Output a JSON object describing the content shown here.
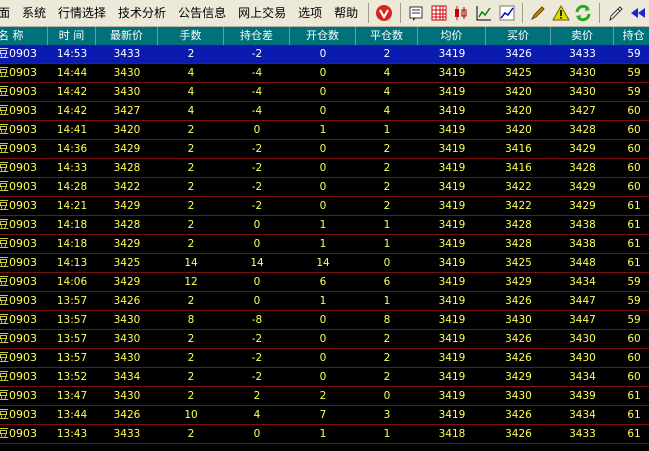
{
  "menu": [
    "面",
    "系统",
    "行情选择",
    "技术分析",
    "公告信息",
    "网上交易",
    "选项",
    "帮助"
  ],
  "toolbar": [
    {
      "icon": "red-circle-v-icon",
      "color": "#d22"
    },
    {
      "icon": "notepad-icon",
      "color": "#333"
    },
    {
      "icon": "grid-table-icon",
      "color": "#c00"
    },
    {
      "icon": "candlestick-icon",
      "color": "#c00"
    },
    {
      "icon": "line-chart-icon",
      "color": "#080"
    },
    {
      "icon": "trend-chart-icon",
      "color": "#00c"
    },
    {
      "icon": "pencil-icon",
      "color": "#c80"
    },
    {
      "icon": "warning-triangle-icon",
      "color": "#dd0"
    },
    {
      "icon": "refresh-arrows-icon",
      "color": "#2a2"
    },
    {
      "icon": "pen-icon",
      "color": "#333"
    },
    {
      "icon": "rewind-icon",
      "color": "#22c"
    }
  ],
  "columns": [
    "名  称",
    "时  间",
    "最新价",
    "手数",
    "持仓差",
    "开仓数",
    "平仓数",
    "均价",
    "买价",
    "卖价",
    "持仓"
  ],
  "rows": [
    [
      "豆0903",
      "14:53",
      "3433",
      "2",
      "-2",
      "0",
      "2",
      "3419",
      "3426",
      "3433",
      "59"
    ],
    [
      "豆0903",
      "14:44",
      "3430",
      "4",
      "-4",
      "0",
      "4",
      "3419",
      "3425",
      "3430",
      "59"
    ],
    [
      "豆0903",
      "14:42",
      "3430",
      "4",
      "-4",
      "0",
      "4",
      "3419",
      "3420",
      "3430",
      "59"
    ],
    [
      "豆0903",
      "14:42",
      "3427",
      "4",
      "-4",
      "0",
      "4",
      "3419",
      "3420",
      "3427",
      "60"
    ],
    [
      "豆0903",
      "14:41",
      "3420",
      "2",
      "0",
      "1",
      "1",
      "3419",
      "3420",
      "3428",
      "60"
    ],
    [
      "豆0903",
      "14:36",
      "3429",
      "2",
      "-2",
      "0",
      "2",
      "3419",
      "3416",
      "3429",
      "60"
    ],
    [
      "豆0903",
      "14:33",
      "3428",
      "2",
      "-2",
      "0",
      "2",
      "3419",
      "3416",
      "3428",
      "60"
    ],
    [
      "豆0903",
      "14:28",
      "3422",
      "2",
      "-2",
      "0",
      "2",
      "3419",
      "3422",
      "3429",
      "60"
    ],
    [
      "豆0903",
      "14:21",
      "3429",
      "2",
      "-2",
      "0",
      "2",
      "3419",
      "3422",
      "3429",
      "61"
    ],
    [
      "豆0903",
      "14:18",
      "3428",
      "2",
      "0",
      "1",
      "1",
      "3419",
      "3428",
      "3438",
      "61"
    ],
    [
      "豆0903",
      "14:18",
      "3429",
      "2",
      "0",
      "1",
      "1",
      "3419",
      "3428",
      "3438",
      "61"
    ],
    [
      "豆0903",
      "14:13",
      "3425",
      "14",
      "14",
      "14",
      "0",
      "3419",
      "3425",
      "3448",
      "61"
    ],
    [
      "豆0903",
      "14:06",
      "3429",
      "12",
      "0",
      "6",
      "6",
      "3419",
      "3429",
      "3434",
      "59"
    ],
    [
      "豆0903",
      "13:57",
      "3426",
      "2",
      "0",
      "1",
      "1",
      "3419",
      "3426",
      "3447",
      "59"
    ],
    [
      "豆0903",
      "13:57",
      "3430",
      "8",
      "-8",
      "0",
      "8",
      "3419",
      "3430",
      "3447",
      "59"
    ],
    [
      "豆0903",
      "13:57",
      "3430",
      "2",
      "-2",
      "0",
      "2",
      "3419",
      "3426",
      "3430",
      "60"
    ],
    [
      "豆0903",
      "13:57",
      "3430",
      "2",
      "-2",
      "0",
      "2",
      "3419",
      "3426",
      "3430",
      "60"
    ],
    [
      "豆0903",
      "13:52",
      "3434",
      "2",
      "-2",
      "0",
      "2",
      "3419",
      "3429",
      "3434",
      "60"
    ],
    [
      "豆0903",
      "13:47",
      "3430",
      "2",
      "2",
      "2",
      "0",
      "3419",
      "3430",
      "3439",
      "61"
    ],
    [
      "豆0903",
      "13:44",
      "3426",
      "10",
      "4",
      "7",
      "3",
      "3419",
      "3426",
      "3434",
      "61"
    ],
    [
      "豆0903",
      "13:43",
      "3433",
      "2",
      "0",
      "1",
      "1",
      "3418",
      "3426",
      "3433",
      "61"
    ]
  ],
  "selected_row": 0,
  "colors": {
    "header_bg": "#00707A",
    "value": "#ffff54",
    "selected_bg": "#0b1bb0",
    "separator": "#7a1010"
  }
}
